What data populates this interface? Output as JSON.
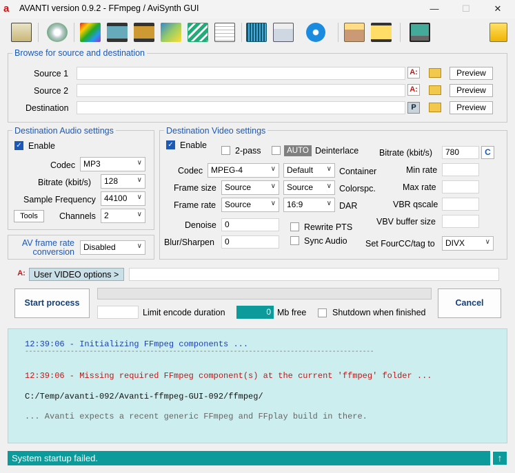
{
  "window": {
    "logo": "a",
    "title": "AVANTI  version  0.9.2  -  FFmpeg / AviSynth GUI",
    "minimize": "—",
    "maximize": "☐",
    "close": "✕"
  },
  "toolbar": {
    "icons": [
      "settings-window-icon",
      "disc-clock-icon",
      "color-bars-icon",
      "film-strip-icon",
      "film-strip-sudfok-icon",
      "image-edit-icon",
      "zigzag-icon",
      "notepad-icon",
      "waveform-icon",
      "folder-open-icon",
      "refresh-arrow-icon",
      "counter-123-icon",
      "film-tools-icon",
      "monitor-icon",
      "help-icon"
    ],
    "colors": {
      "accent": "#1b58b8",
      "folder": "#f2c94c"
    }
  },
  "browse": {
    "title": "Browse for source and destination",
    "source1_label": "Source 1",
    "source2_label": "Source 2",
    "destination_label": "Destination",
    "source1_value": "",
    "source2_value": "",
    "destination_value": "",
    "a_icon": "A:",
    "p_icon": "P",
    "preview_label": "Preview"
  },
  "audio": {
    "title": "Destination Audio settings",
    "enable_label": "Enable",
    "codec_label": "Codec",
    "codec_value": "MP3",
    "bitrate_label": "Bitrate (kbit/s)",
    "bitrate_value": "128",
    "samplefreq_label": "Sample Frequency",
    "samplefreq_value": "44100",
    "tools_label": "Tools",
    "channels_label": "Channels",
    "channels_value": "2"
  },
  "avframe": {
    "label_line1": "AV frame rate",
    "label_line2": "conversion",
    "value": "Disabled"
  },
  "video": {
    "title": "Destination Video settings",
    "enable_label": "Enable",
    "twopass_label": "2-pass",
    "auto_label": "AUTO",
    "deinterlace_label": "Deinterlace",
    "bitrate_label": "Bitrate (kbit/s)",
    "bitrate_value": "780",
    "c_button": "C",
    "codec_label": "Codec",
    "codec_value": "MPEG-4",
    "container_value": "Default",
    "container_label": "Container",
    "minrate_label": "Min rate",
    "framesize_label": "Frame size",
    "framesize_value": "Source",
    "colorspc_value": "Source",
    "colorspc_label": "Colorspc.",
    "maxrate_label": "Max rate",
    "framerate_label": "Frame rate",
    "framerate_value": "Source",
    "dar_value": "16:9",
    "dar_label": "DAR",
    "vbrq_label": "VBR qscale",
    "denoise_label": "Denoise",
    "denoise_value": "0",
    "rewrite_label": "Rewrite PTS",
    "vbv_label": "VBV buffer size",
    "blur_label": "Blur/Sharpen",
    "blur_value": "0",
    "sync_label": "Sync Audio",
    "fourcc_label": "Set FourCC/tag to",
    "fourcc_value": "DIVX"
  },
  "user_options": {
    "icon": "A:",
    "button_label": "User VIDEO options >",
    "value": ""
  },
  "process": {
    "start_label": "Start process",
    "cancel_label": "Cancel",
    "limit_value": "",
    "limit_label": "Limit encode duration",
    "mb_value": "0",
    "mb_label": "Mb free",
    "shutdown_label": "Shutdown when finished",
    "progress": 0
  },
  "log": {
    "line1": "12:39:06 - Initializing FFmpeg components ...",
    "separator": "--------------------------------------------------------------------------------------------",
    "line2": "12:39:06 - Missing required FFmpeg component(s) at the current 'ffmpeg' folder ...",
    "line3": "C:/Temp/avanti-092/Avanti-ffmpeg-GUI-092/ffmpeg/",
    "line4": "... Avanti expects a recent generic FFmpeg and FFplay build in there.",
    "colors": {
      "info": "#1b3fb8",
      "error": "#c01818",
      "path": "#111111",
      "note": "#666666"
    }
  },
  "status": {
    "text": "System startup failed.",
    "up_icon": "↑"
  }
}
